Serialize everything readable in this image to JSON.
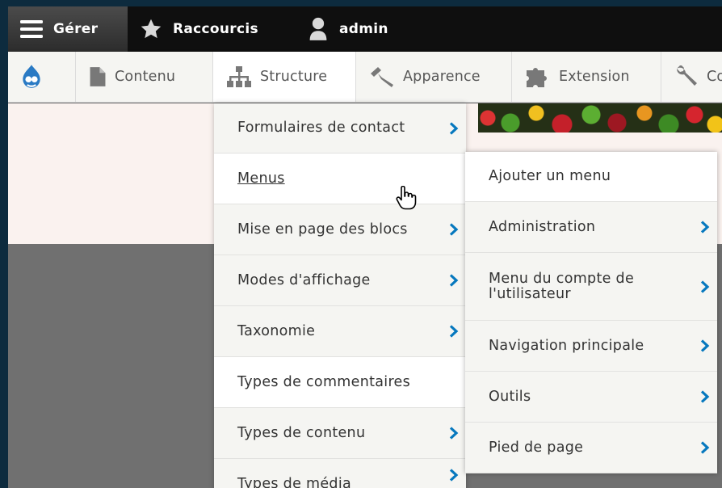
{
  "toolbar": {
    "manage": {
      "label": "Gérer",
      "icon": "hamburger-icon"
    },
    "shortcuts": {
      "label": "Raccourcis",
      "icon": "star-icon"
    },
    "user": {
      "label": "admin",
      "icon": "user-icon"
    }
  },
  "tray": {
    "home_icon": "drupal-drop-icon",
    "items": [
      {
        "label": "Contenu",
        "icon": "file-icon"
      },
      {
        "label": "Structure",
        "icon": "sitemap-icon"
      },
      {
        "label": "Apparence",
        "icon": "paintbrush-icon"
      },
      {
        "label": "Extension",
        "icon": "puzzle-icon"
      },
      {
        "label": "Co",
        "icon": "wrench-icon"
      }
    ]
  },
  "structure_menu": {
    "items": [
      {
        "label": "Formulaires de contact",
        "has_children": true
      },
      {
        "label": "Menus",
        "has_children": false
      },
      {
        "label": "Mise en page des blocs",
        "has_children": true
      },
      {
        "label": "Modes d'affichage",
        "has_children": true
      },
      {
        "label": "Taxonomie",
        "has_children": true
      },
      {
        "label": "Types de commentaires",
        "has_children": false
      },
      {
        "label": "Types de contenu",
        "has_children": true
      },
      {
        "label": "Types de média",
        "has_children": true
      }
    ]
  },
  "menus_submenu": {
    "items": [
      {
        "label": "Ajouter un menu",
        "has_children": false
      },
      {
        "label": "Administration",
        "has_children": true
      },
      {
        "label": "Menu du compte de l'utilisateur",
        "has_children": true
      },
      {
        "label": "Navigation principale",
        "has_children": true
      },
      {
        "label": "Outils",
        "has_children": true
      },
      {
        "label": "Pied de page",
        "has_children": true
      }
    ]
  },
  "colors": {
    "toolbar_bg": "#0f0f0f",
    "tray_bg": "#f5f5f2",
    "chevron": "#0678be",
    "page_bg_dark": "#707070"
  }
}
